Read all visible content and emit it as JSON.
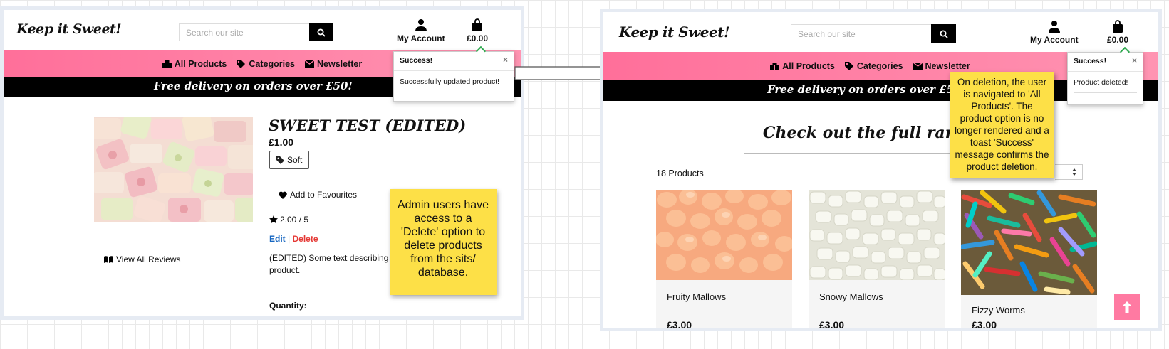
{
  "brand": {
    "logo": "Keep it Sweet!",
    "pink": "#ff7aa2",
    "accent": "#2fa84f"
  },
  "search": {
    "placeholder": "Search our site"
  },
  "header": {
    "account_label": "My Account",
    "bag_total": "£0.00"
  },
  "nav": {
    "all_products": "All Products",
    "categories": "Categories",
    "newsletter": "Newsletter"
  },
  "banner": "Free delivery on orders over £50!",
  "left": {
    "toast": {
      "title": "Success!",
      "message": "Successfully updated product!",
      "close": "×"
    },
    "product": {
      "name": "SWEET TEST (EDITED)",
      "price": "£1.00",
      "tag": "Soft",
      "favourites": "Add to Favourites",
      "rating": "2.00 / 5",
      "edit": "Edit",
      "separator": "|",
      "delete": "Delete",
      "description_line1": "(EDITED) Some text describing",
      "description_line2": "product.",
      "quantity_label": "Quantity:",
      "view_reviews": "View All Reviews",
      "image": "pastel-marshmallows-photo"
    },
    "note": "Admin users have access to a 'Delete' option to delete products from the sits/ database."
  },
  "right": {
    "toast": {
      "title": "Success!",
      "message": "Product deleted!",
      "close": "×"
    },
    "heading": "Check out the full range",
    "count": "18 Products",
    "products": [
      {
        "name": "Fruity Mallows",
        "price": "£3.00",
        "image": "orange-mallows-photo"
      },
      {
        "name": "Snowy Mallows",
        "price": "£3.00",
        "image": "white-mallows-photo"
      },
      {
        "name": "Fizzy Worms",
        "price": "£3.00",
        "image": "fizzy-worms-photo"
      }
    ],
    "note": "On deletion, the user is navigated to 'All Products'. The product option is no longer rendered and a toast 'Success' message confirms the product deletion.",
    "back_to_top": "arrow-up-icon"
  }
}
